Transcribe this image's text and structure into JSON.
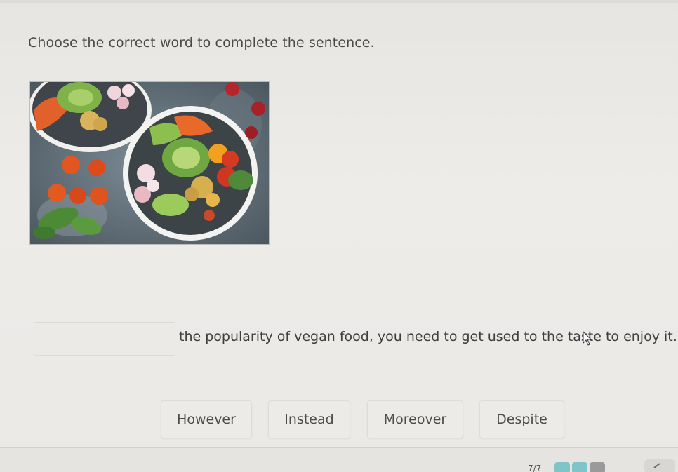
{
  "question": {
    "instruction": "Choose the correct word to complete the sentence.",
    "sentence_rest": "the popularity of vegan food, you need to get used to the taste to enjoy it.",
    "blank_value": ""
  },
  "options": [
    {
      "label": "However"
    },
    {
      "label": "Instead"
    },
    {
      "label": "Moreover"
    },
    {
      "label": "Despite"
    }
  ],
  "footer": {
    "page_counter": "7/7"
  },
  "colors": {
    "background": "#eceae7",
    "text": "#3e3e3e",
    "option_border": "#dedcd9",
    "progress_active": "#7fc4c8",
    "progress_inactive": "#9a9a9a"
  },
  "icons": {
    "photo": "vegan-bowls-photo",
    "cursor": "mouse-cursor-icon",
    "corner": "check-icon"
  }
}
